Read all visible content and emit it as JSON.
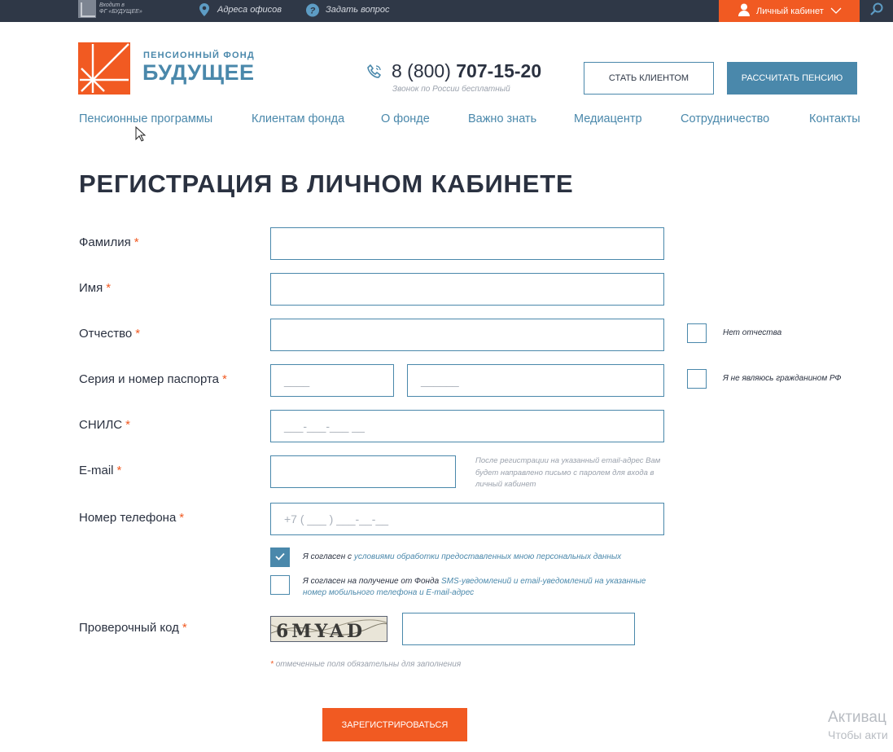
{
  "topbar": {
    "group_line1": "Входит в",
    "group_line2": "ФГ «БУДУЩЕЕ»",
    "offices": "Адреса офисов",
    "ask": "Задать вопрос",
    "cabinet": "Личный кабинет"
  },
  "header": {
    "brand_sub": "ПЕНСИОННЫЙ ФОНД",
    "brand_main": "БУДУЩЕЕ",
    "phone_prefix": "8 (800) ",
    "phone_number": "707-15-20",
    "phone_note": "Звонок по России бесплатный",
    "btn_client": "СТАТЬ КЛИЕНТОМ",
    "btn_calc": "РАССЧИТАТЬ ПЕНСИЮ"
  },
  "nav": [
    "Пенсионные программы",
    "Клиентам фонда",
    "О фонде",
    "Важно знать",
    "Медиацентр",
    "Сотрудничество",
    "Контакты"
  ],
  "page_title": "РЕГИСТРАЦИЯ В ЛИЧНОМ КАБИНЕТЕ",
  "required_mark": "*",
  "form": {
    "surname_label": "Фамилия",
    "name_label": "Имя",
    "patronymic_label": "Отчество",
    "no_patronymic": "Нет отчества",
    "passport_label": "Серия и номер паспорта",
    "passport_series_ph": "____",
    "passport_number_ph": "______",
    "not_citizen": "Я не являюсь гражданином РФ",
    "snils_label": "СНИЛС",
    "snils_ph": "___-___-___ __",
    "email_label": "E-mail",
    "email_note": "После регистрации на указанный email-адрес Вам будет направлено письмо с паролем для входа в личный кабинет",
    "phone_label": "Номер телефона",
    "phone_ph": "+7 ( ___ ) ___-__-__",
    "agree1_text": "Я согласен с ",
    "agree1_link": "условиями обработки предоставленных мною персональных данных",
    "agree1_checked": true,
    "agree2_text": "Я согласен на получение от Фонда ",
    "agree2_link": "SMS-уведомлений и email-уведомлений на указанные номер мобильного телефона и E-mail-адрес",
    "agree2_checked": false,
    "captcha_label": "Проверочный код",
    "captcha_text": "6MYAD",
    "required_note": "отмеченные поля обязательны для заполнения",
    "submit": "ЗАРЕГИСТРИРОВАТЬСЯ"
  },
  "watermark": {
    "line1": "Активац",
    "line2": "Чтобы акти"
  },
  "colors": {
    "accent": "#f15a22",
    "brand": "#4a88ab",
    "topbar": "#2f3847"
  }
}
